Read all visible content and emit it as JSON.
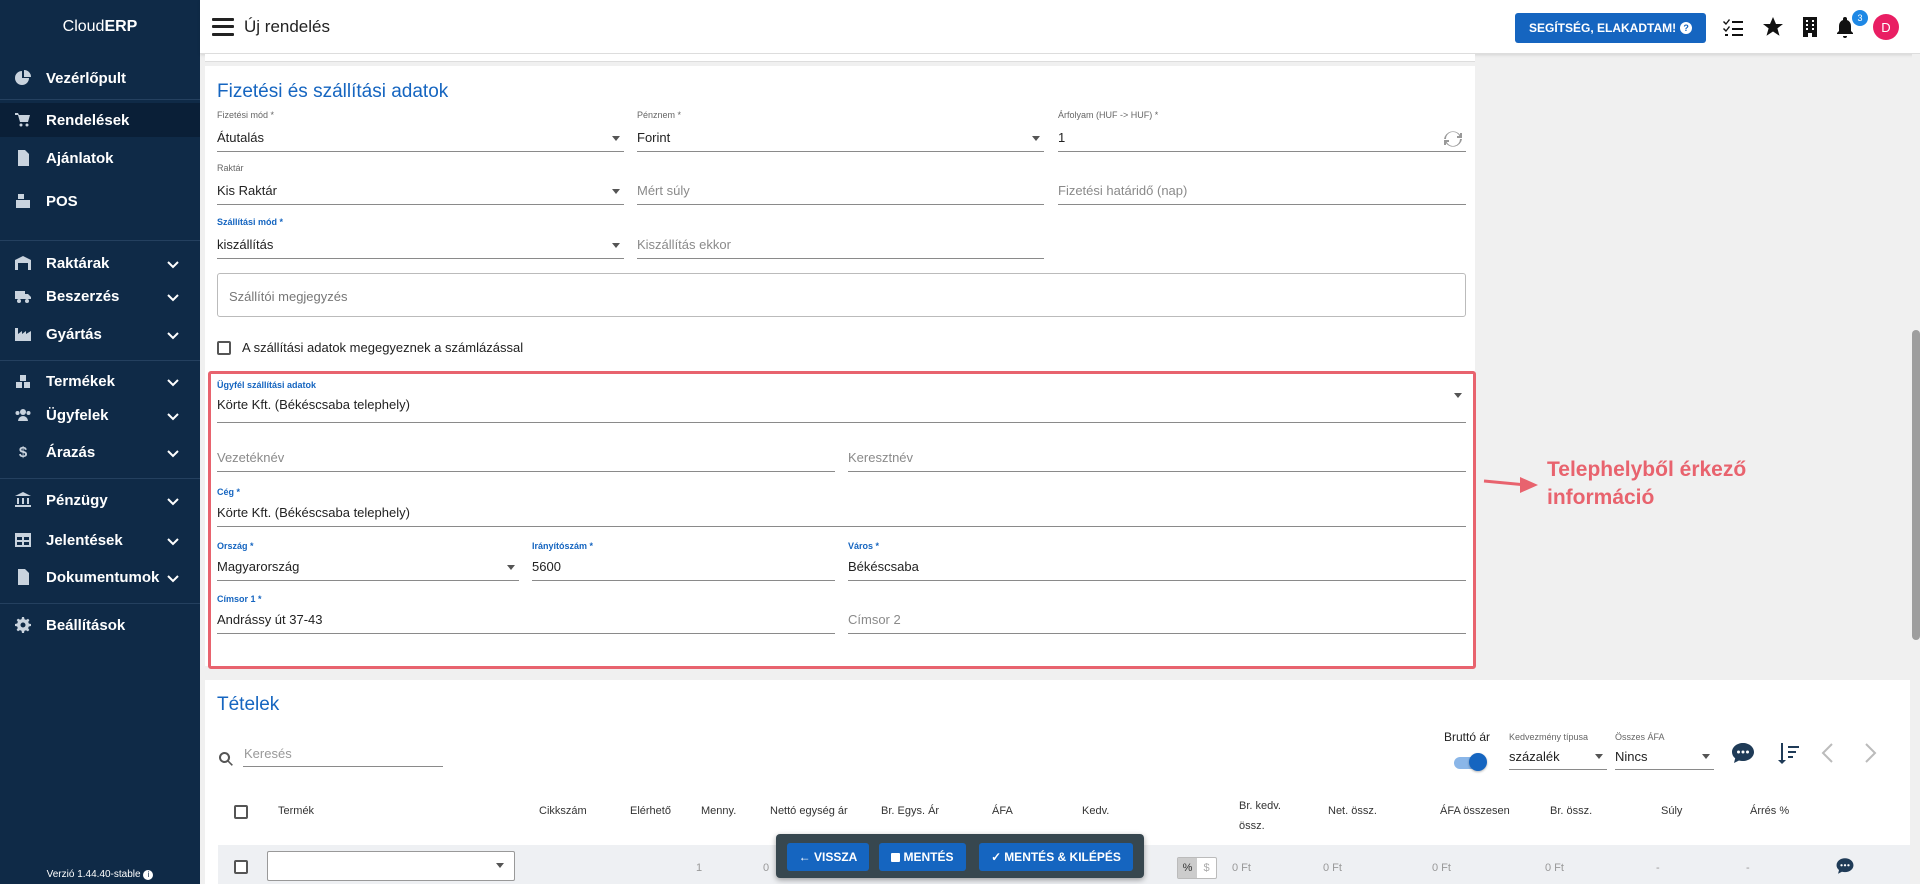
{
  "app": {
    "logo_plain": "Cloud",
    "logo_bold": "ERP",
    "version": "Verzió 1.44.40-stable"
  },
  "sidebar": {
    "items": [
      {
        "label": "Vezérlőpult",
        "icon": "dashboard-pie-icon"
      },
      {
        "label": "Rendelések",
        "icon": "cart-icon",
        "active": true
      },
      {
        "label": "Ajánlatok",
        "icon": "document-icon"
      },
      {
        "label": "POS",
        "icon": "cash-register-icon"
      },
      {
        "label": "Raktárak",
        "icon": "warehouse-icon",
        "expandable": true
      },
      {
        "label": "Beszerzés",
        "icon": "truck-icon",
        "expandable": true
      },
      {
        "label": "Gyártás",
        "icon": "factory-icon",
        "expandable": true
      },
      {
        "label": "Termékek",
        "icon": "boxes-icon",
        "expandable": true
      },
      {
        "label": "Ügyfelek",
        "icon": "users-icon",
        "expandable": true
      },
      {
        "label": "Árazás",
        "icon": "dollar-icon",
        "expandable": true
      },
      {
        "label": "Pénzügy",
        "icon": "bank-icon",
        "expandable": true
      },
      {
        "label": "Jelentések",
        "icon": "table-icon",
        "expandable": true
      },
      {
        "label": "Dokumentumok",
        "icon": "file-icon",
        "expandable": true
      },
      {
        "label": "Beállítások",
        "icon": "gear-icon"
      }
    ]
  },
  "topbar": {
    "title": "Új rendelés",
    "help_button": "SEGÍTSÉG, ELAKADTAM!",
    "notification_count": "3",
    "avatar_letter": "D"
  },
  "payment": {
    "section_title": "Fizetési és szállítási adatok",
    "fizetesi_mod": {
      "label": "Fizetési mód *",
      "value": "Átutalás"
    },
    "penznem": {
      "label": "Pénznem *",
      "value": "Forint"
    },
    "arfolyam": {
      "label": "Árfolyam (HUF -> HUF) *",
      "value": "1"
    },
    "raktar": {
      "label": "Raktár",
      "value": "Kis Raktár"
    },
    "mert_suly": {
      "placeholder": "Mért súly"
    },
    "fizetesi_hatarido": {
      "placeholder": "Fizetési határidő (nap)"
    },
    "szallitasi_mod": {
      "label": "Szállítási mód *",
      "value": "kiszállítás"
    },
    "kiszallitas_ekkor": {
      "placeholder": "Kiszállítás ekkor"
    },
    "szallitoi_megjegyzes": {
      "placeholder": "Szállítói megjegyzés"
    },
    "same_as_billing": "A szállítási adatok megegyeznek a számlázással"
  },
  "shipping": {
    "ugyfel": {
      "label": "Ügyfél szállítási adatok",
      "value": "Körte Kft. (Békéscsaba telephely)"
    },
    "vezeteknev": {
      "placeholder": "Vezetéknév"
    },
    "keresztnev": {
      "placeholder": "Keresztnév"
    },
    "ceg": {
      "label": "Cég *",
      "value": "Körte Kft. (Békéscsaba telephely)"
    },
    "orszag": {
      "label": "Ország *",
      "value": "Magyarország"
    },
    "iranyitoszam": {
      "label": "Irányítószám *",
      "value": "5600"
    },
    "varos": {
      "label": "Város *",
      "value": "Békéscsaba"
    },
    "cimsor1": {
      "label": "Címsor 1 *",
      "value": "Andrássy út 37-43"
    },
    "cimsor2": {
      "placeholder": "Címsor 2"
    }
  },
  "annotation": {
    "line1": "Telephelyből érkező",
    "line2": "információ",
    "color": "#e8636e"
  },
  "items": {
    "section_title": "Tételek",
    "search_placeholder": "Keresés",
    "brutto_label": "Bruttó ár",
    "brutto_on": true,
    "kedvezmeny_tipusa": {
      "label": "Kedvezmény típusa",
      "value": "százalék"
    },
    "osszes_afa": {
      "label": "Összes ÁFA",
      "value": "Nincs"
    },
    "columns": [
      "Termék",
      "Cikkszám",
      "Elérhető",
      "Menny.",
      "Nettó egység ár",
      "Br. Egys. Ár",
      "ÁFA",
      "Kedv.",
      "Br. kedv.",
      "össz.",
      "Net. össz.",
      "ÁFA összesen",
      "Br. össz.",
      "Súly",
      "Árrés %"
    ],
    "row": {
      "menny": "1",
      "netto": "0",
      "pct": "%",
      "dollar": "$",
      "br_kedv_ossz": "0 Ft",
      "net_ossz": "0 Ft",
      "afa_osszesen": "0 Ft",
      "br_ossz": "0 Ft",
      "suly": "-",
      "arres": "-"
    }
  },
  "actions": {
    "back": "← VISSZA",
    "save": "MENTÉS",
    "save_exit": "MENTÉS & KILÉPÉS"
  },
  "colors": {
    "sidebar": "#0f2a47",
    "accent": "#1565c0",
    "highlight": "#e8636e"
  }
}
